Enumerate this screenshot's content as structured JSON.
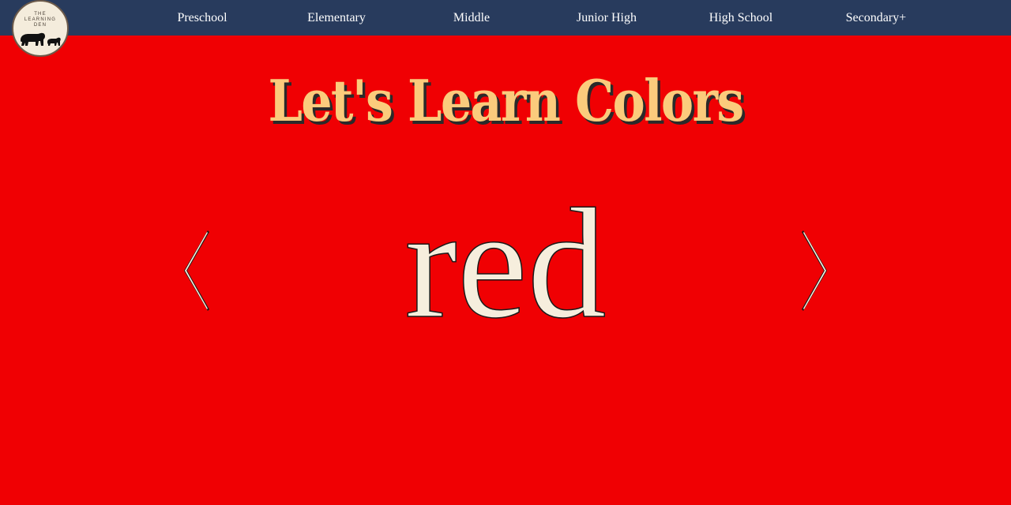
{
  "logo": {
    "text": "THE\nLEARNING\nDEN"
  },
  "nav": {
    "items": [
      {
        "label": "Preschool"
      },
      {
        "label": "Elementary"
      },
      {
        "label": "Middle"
      },
      {
        "label": "Junior High"
      },
      {
        "label": "High School"
      },
      {
        "label": "Secondary+"
      }
    ]
  },
  "main": {
    "title": "Let's Learn Colors",
    "current_color": "red"
  },
  "colors": {
    "background": "#f00003",
    "navbar": "#283b5d",
    "title": "#fbcb7c",
    "word": "#f6eedd"
  },
  "icons": {
    "prev": "chevron-left-icon",
    "next": "chevron-right-icon",
    "logo": "bear-icon"
  }
}
